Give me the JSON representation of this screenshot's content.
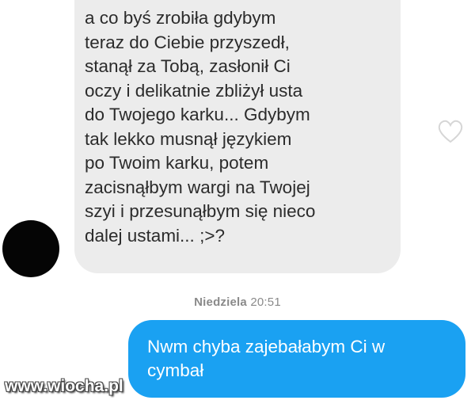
{
  "thread": {
    "incoming_message": "a co byś zrobiła gdybym\nteraz do Ciebie przyszedł,\nstanął za Tobą, zasłonił Ci\noczy i delikatnie zbliżył usta\ndo Twojego karku... Gdybym\ntak lekko musnął językiem\npo Twoim karku, potem\nzacisnąłbym wargi na Twojej\nszyi i przesunąłbym się nieco\ndalej ustami... ;>?",
    "timestamp_day": "Niedziela",
    "timestamp_time": "20:51",
    "outgoing_message": "Nwm chyba zajebałabym Ci w\ncymbał"
  },
  "watermark": "www.wiocha.pl",
  "icons": {
    "like": "heart-outline-icon"
  },
  "colors": {
    "incoming_bubble": "#ececec",
    "outgoing_bubble": "#1aa1f2",
    "timestamp": "#8a8a8a"
  }
}
